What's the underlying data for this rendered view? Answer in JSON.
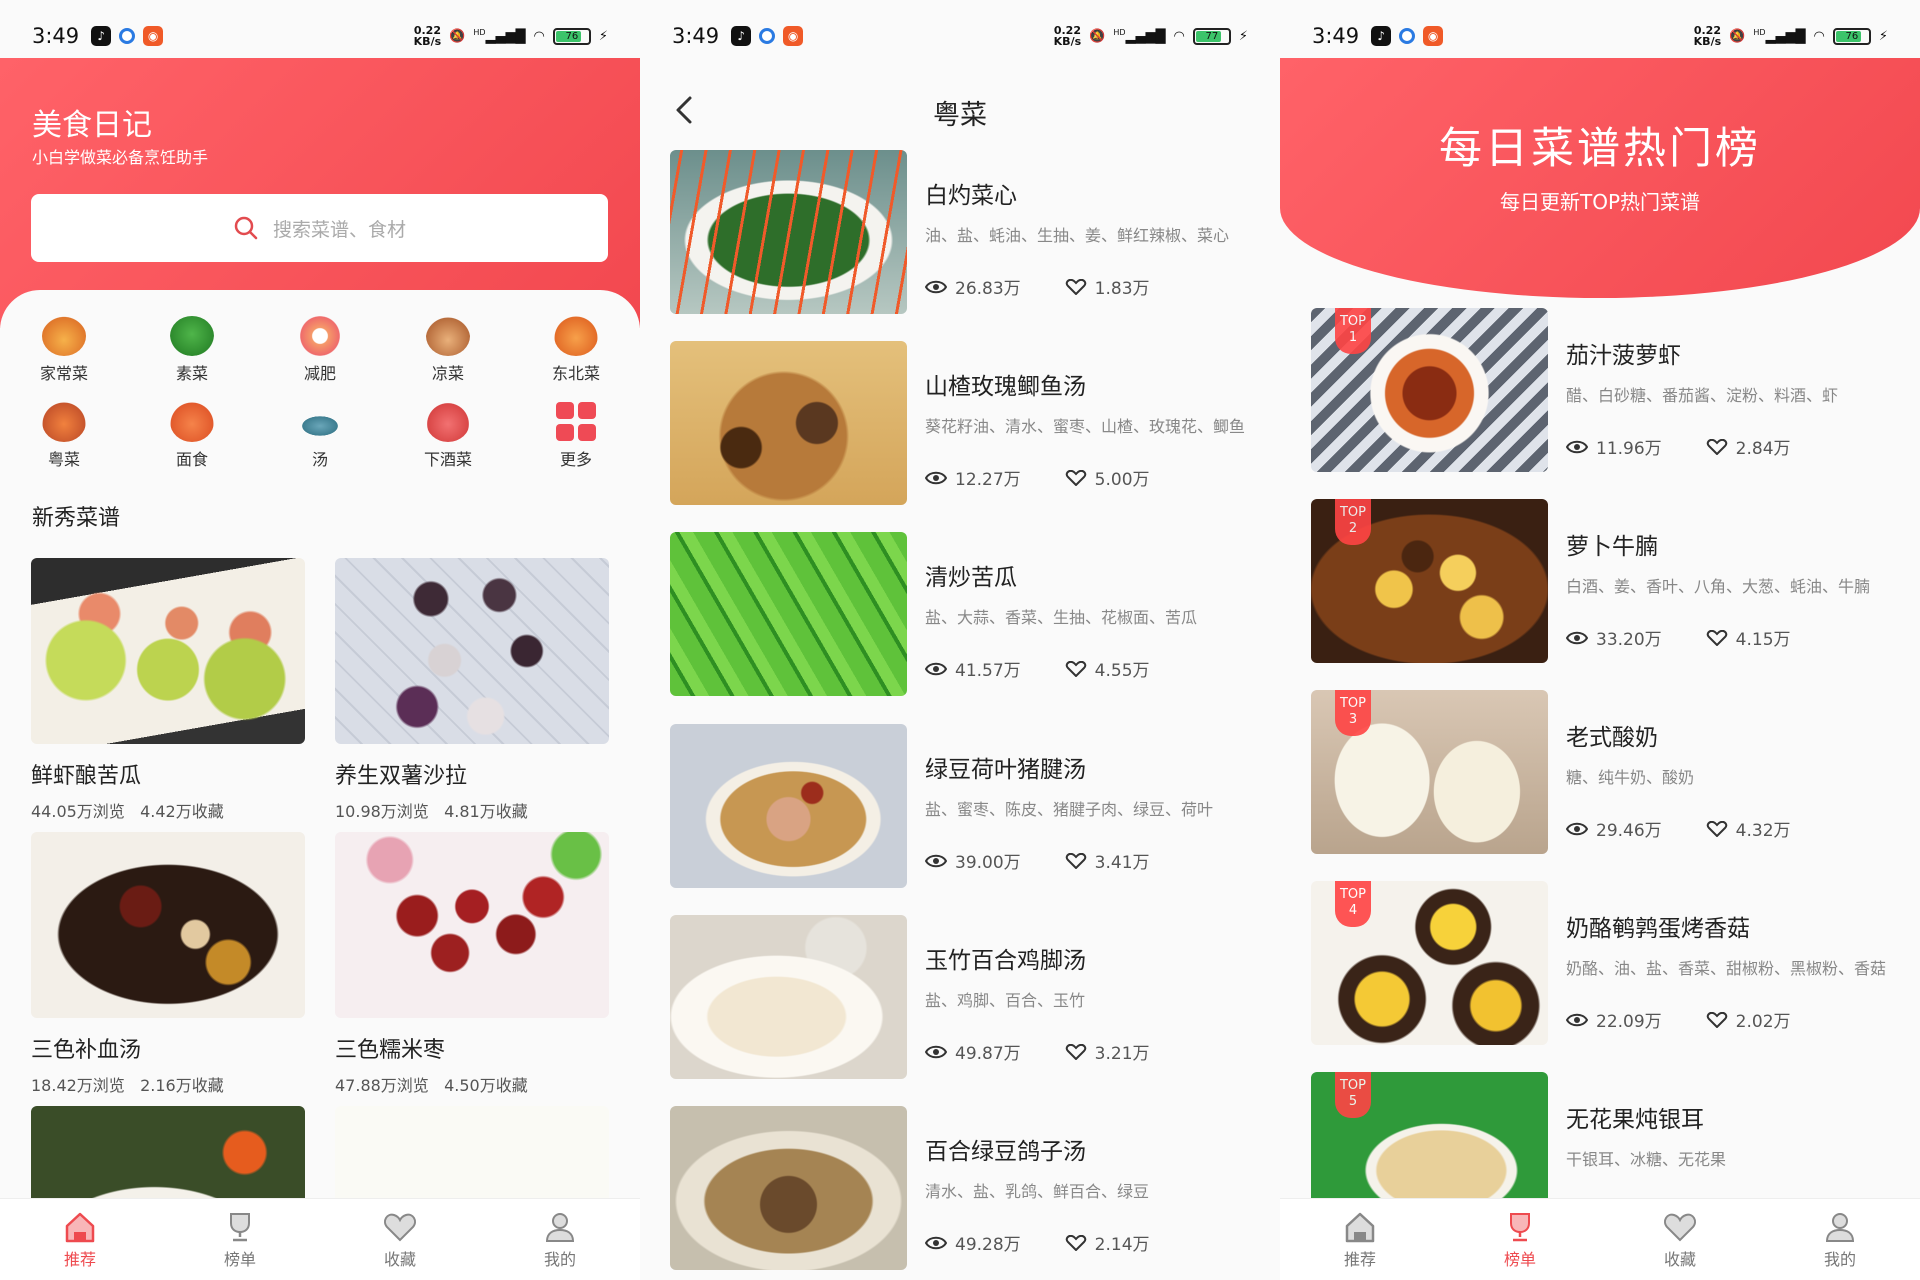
{
  "status": {
    "time": "3:49",
    "speed_top": "0.22",
    "speed_bottom": "KB/s",
    "hd": "HD",
    "battery_p1": "76",
    "battery_p2": "77",
    "battery_p3": "76"
  },
  "home": {
    "title": "美食日记",
    "subtitle": "小白学做菜必备烹饪助手",
    "search_placeholder": "搜索菜谱、食材",
    "categories": [
      "家常菜",
      "素菜",
      "减肥",
      "凉菜",
      "东北菜",
      "粤菜",
      "面食",
      "汤",
      "下酒菜",
      "更多"
    ],
    "section_title": "新秀菜谱",
    "cards": [
      {
        "name": "鲜虾酿苦瓜",
        "views": "44.05万浏览",
        "favs": "4.42万收藏"
      },
      {
        "name": "养生双薯沙拉",
        "views": "10.98万浏览",
        "favs": "4.81万收藏"
      },
      {
        "name": "三色补血汤",
        "views": "18.42万浏览",
        "favs": "2.16万收藏"
      },
      {
        "name": "三色糯米枣",
        "views": "47.88万浏览",
        "favs": "4.50万收藏"
      }
    ]
  },
  "list": {
    "title": "粤菜",
    "items": [
      {
        "name": "白灼菜心",
        "ingredients": "油、盐、蚝油、生抽、姜、鲜红辣椒、菜心",
        "views": "26.83万",
        "likes": "1.83万"
      },
      {
        "name": "山楂玫瑰鲫鱼汤",
        "ingredients": "葵花籽油、清水、蜜枣、山楂、玫瑰花、鲫鱼",
        "views": "12.27万",
        "likes": "5.00万"
      },
      {
        "name": "清炒苦瓜",
        "ingredients": "盐、大蒜、香菜、生抽、花椒面、苦瓜",
        "views": "41.57万",
        "likes": "4.55万"
      },
      {
        "name": "绿豆荷叶猪腱汤",
        "ingredients": "盐、蜜枣、陈皮、猪腱子肉、绿豆、荷叶",
        "views": "39.00万",
        "likes": "3.41万"
      },
      {
        "name": "玉竹百合鸡脚汤",
        "ingredients": "盐、鸡脚、百合、玉竹",
        "views": "49.87万",
        "likes": "3.21万"
      },
      {
        "name": "百合绿豆鸽子汤",
        "ingredients": "清水、盐、乳鸽、鲜百合、绿豆",
        "views": "49.28万",
        "likes": "2.14万"
      }
    ]
  },
  "ranking": {
    "title": "每日菜谱热门榜",
    "subtitle": "每日更新TOP热门菜谱",
    "items": [
      {
        "top": "TOP",
        "rank": "1",
        "name": "茄汁菠萝虾",
        "ingredients": "醋、白砂糖、番茄酱、淀粉、料酒、虾",
        "views": "11.96万",
        "likes": "2.84万"
      },
      {
        "top": "TOP",
        "rank": "2",
        "name": "萝卜牛腩",
        "ingredients": "白酒、姜、香叶、八角、大葱、蚝油、牛腩",
        "views": "33.20万",
        "likes": "4.15万"
      },
      {
        "top": "TOP",
        "rank": "3",
        "name": "老式酸奶",
        "ingredients": "糖、纯牛奶、酸奶",
        "views": "29.46万",
        "likes": "4.32万"
      },
      {
        "top": "TOP",
        "rank": "4",
        "name": "奶酪鹌鹑蛋烤香菇",
        "ingredients": "奶酪、油、盐、香菜、甜椒粉、黑椒粉、香菇",
        "views": "22.09万",
        "likes": "2.02万"
      },
      {
        "top": "TOP",
        "rank": "5",
        "name": "无花果炖银耳",
        "ingredients": "干银耳、冰糖、无花果"
      }
    ]
  },
  "tabs": [
    "推荐",
    "榜单",
    "收藏",
    "我的"
  ],
  "colors": {
    "accent": "#ee4a4f",
    "hero": "#f5525a"
  }
}
